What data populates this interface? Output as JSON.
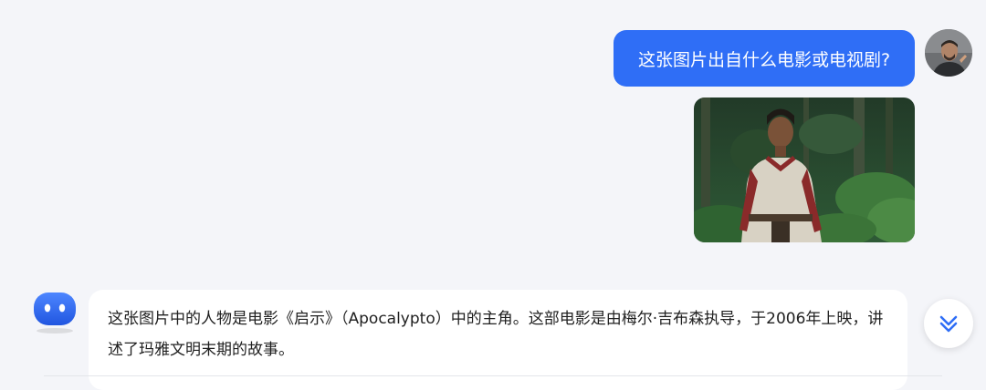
{
  "user_message": {
    "text": "这张图片出自什么电影或电视剧?"
  },
  "bot_message": {
    "text": "这张图片中的人物是电影《启示》（Apocalypto）中的主角。这部电影是由梅尔·吉布森执导，于2006年上映，讲述了玛雅文明末期的故事。"
  },
  "colors": {
    "accent": "#2f6ef6",
    "background": "#f4f5f9",
    "card": "#ffffff"
  },
  "icons": {
    "scroll_down": "double-chevron-down-icon",
    "bot_avatar": "bot-face-icon"
  }
}
